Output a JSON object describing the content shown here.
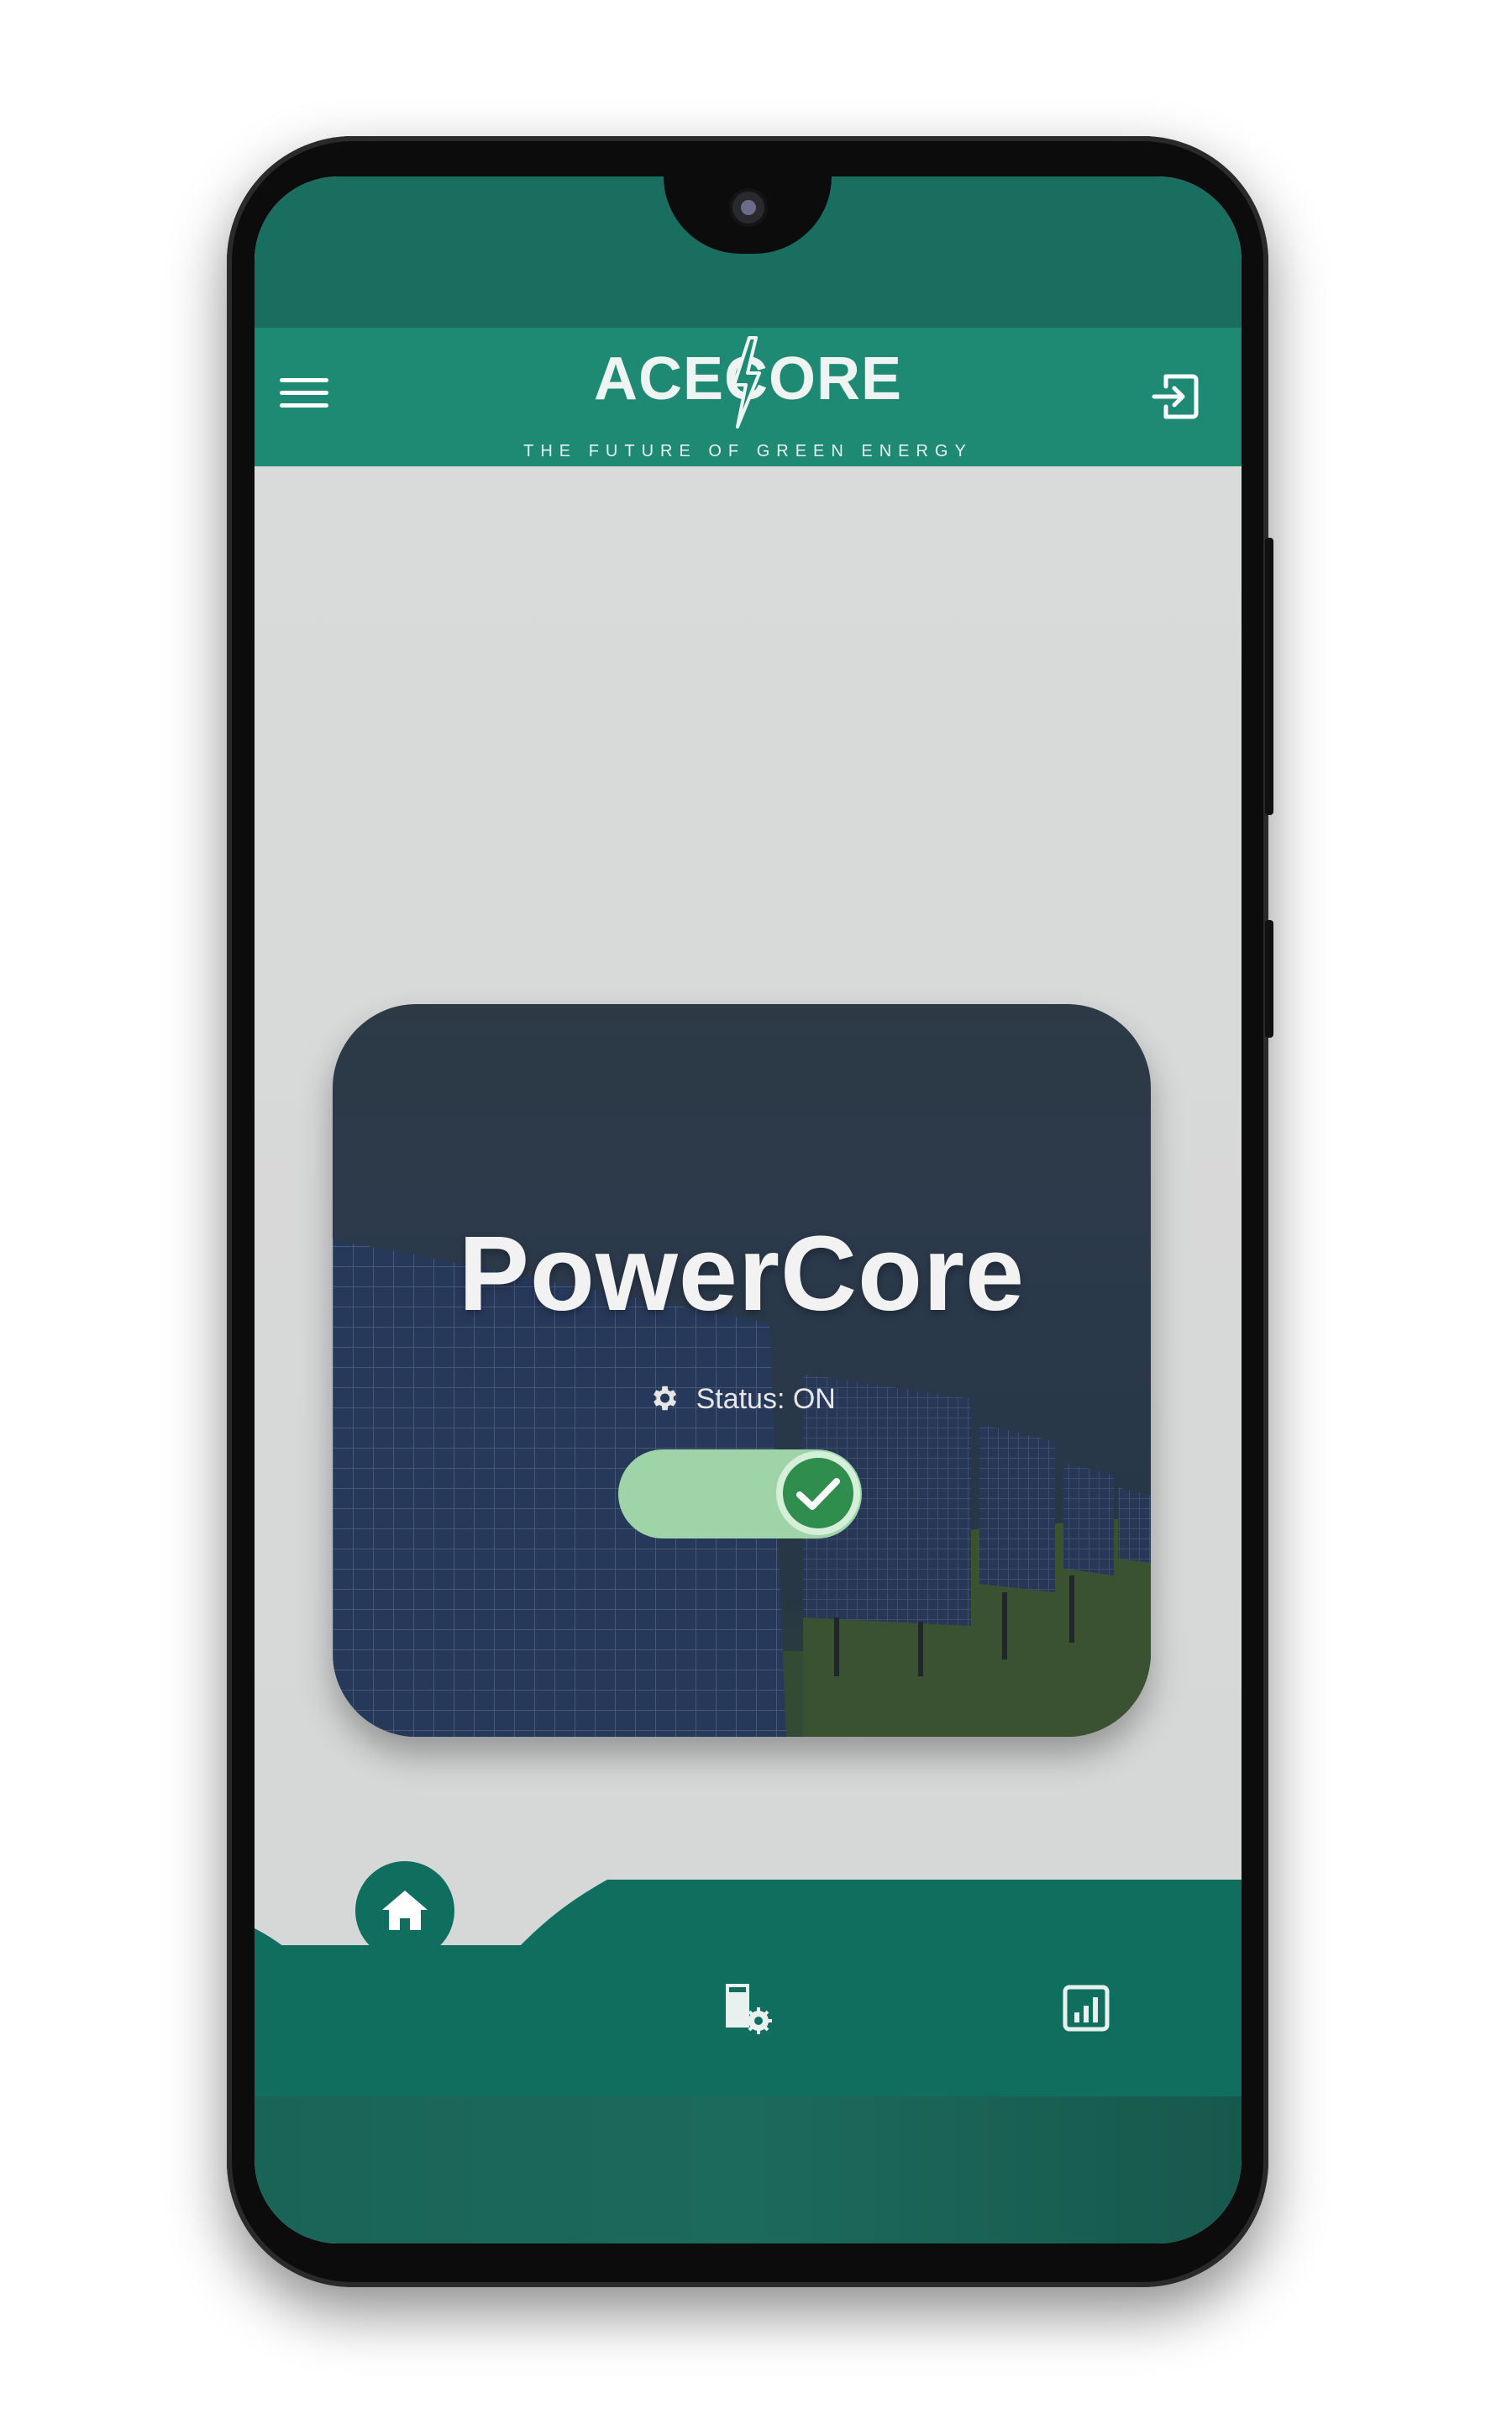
{
  "header": {
    "logo_text": "ACECORE",
    "tagline": "THE FUTURE OF GREEN ENERGY",
    "menu_icon": "hamburger-menu-icon",
    "logout_icon": "logout-icon"
  },
  "card": {
    "title": "PowerCore",
    "status_text": "Status: ON",
    "status_icon": "gear-icon",
    "toggle_state": "on",
    "background_image": "solar-panels-field"
  },
  "bottom_nav": {
    "items": [
      {
        "name": "home",
        "icon": "home-icon",
        "active": true
      },
      {
        "name": "device-settings",
        "icon": "device-settings-icon",
        "active": false
      },
      {
        "name": "statistics",
        "icon": "statistics-icon",
        "active": false
      }
    ]
  },
  "colors": {
    "primary": "#1f8a74",
    "nav": "#0f6e5d",
    "background": "#d8d9d9",
    "toggle_track": "#9ed4a8",
    "toggle_knob": "#2f8d4e"
  }
}
